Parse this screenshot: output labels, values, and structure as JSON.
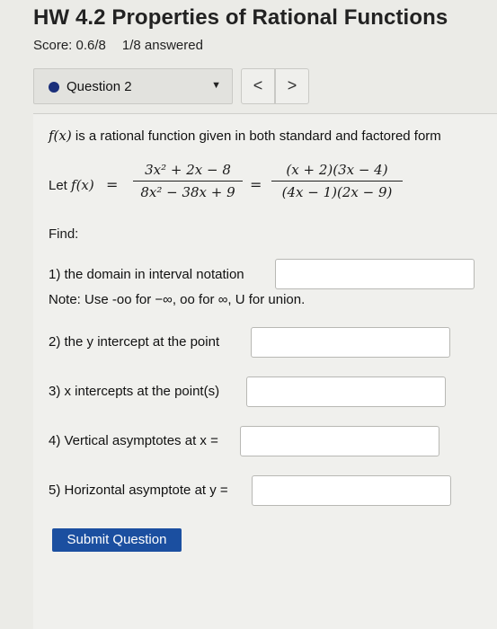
{
  "header": {
    "title": "HW 4.2 Properties of Rational Functions",
    "score": "Score: 0.6/8",
    "answered": "1/8 answered"
  },
  "question_nav": {
    "selected": "Question 2",
    "prev_symbol": "<",
    "next_symbol": ">"
  },
  "problem": {
    "intro_func": "f(x)",
    "intro_text": " is a rational function given in both standard and factored form",
    "let_label": "Let ",
    "let_func": "f(x)",
    "standard_numerator": "3x² + 2x − 8",
    "standard_denominator": "8x² − 38x + 9",
    "factored_numerator": "(x + 2)(3x − 4)",
    "factored_denominator": "(4x − 1)(2x − 9)",
    "find_label": "Find:",
    "q1": "1) the domain in interval notation",
    "note": "Note: Use -oo for −∞, oo for ∞, U for union.",
    "q2": "2) the y intercept at the point",
    "q3": "3) x intercepts at the point(s)",
    "q4": "4) Vertical asymptotes at x =",
    "q5": "5) Horizontal asymptote at y =",
    "submit_label": "Submit Question"
  }
}
